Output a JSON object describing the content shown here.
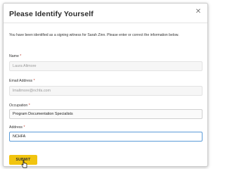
{
  "dialog": {
    "title": "Please Identify Yourself",
    "close_icon": "close-icon",
    "intro": "You have been identified as a signing witness for Sarah Zinn. Please enter or correct the information below."
  },
  "fields": {
    "name": {
      "label": "Name",
      "required_mark": "*",
      "value": "Laura Altmore"
    },
    "email": {
      "label": "Email Address",
      "required_mark": "*",
      "value": "lmaltmore@nchfa.com"
    },
    "occupation": {
      "label": "Occupation",
      "required_mark": "*",
      "value": "Program Documentation Specialists"
    },
    "address": {
      "label": "Address",
      "required_mark": "*",
      "value": "NCHFA"
    }
  },
  "actions": {
    "submit_label": "SUBMIT",
    "submit_color": "#f1c40f"
  }
}
